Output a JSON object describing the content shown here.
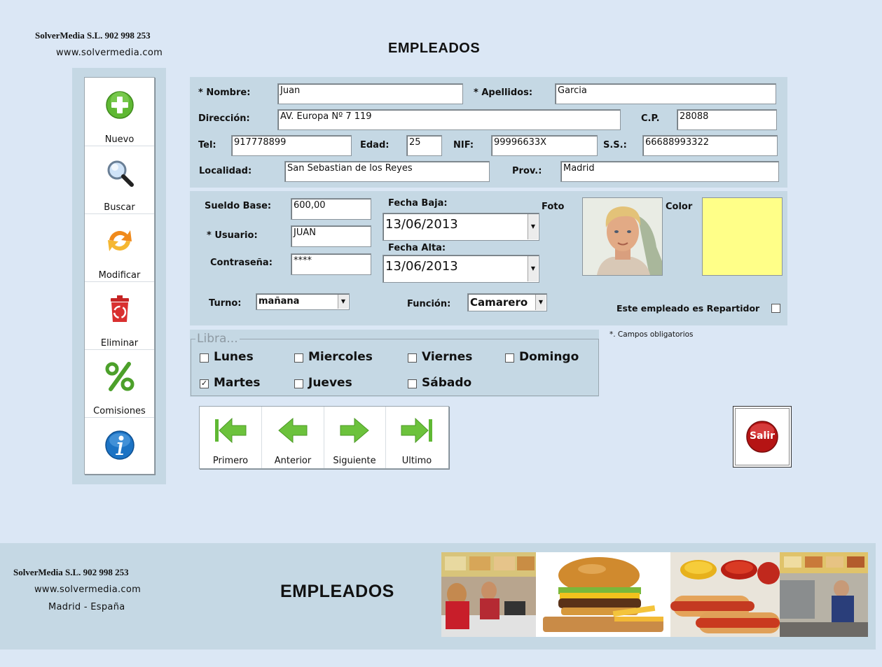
{
  "header": {
    "company": "SolverMedia S.L. 902 998 253",
    "website": "www.solvermedia.com",
    "title": "EMPLEADOS"
  },
  "sidebar": {
    "items": [
      {
        "label": "Nuevo",
        "icon": "plus-icon"
      },
      {
        "label": "Buscar",
        "icon": "magnifier-icon"
      },
      {
        "label": "Modificar",
        "icon": "refresh-arrows-icon"
      },
      {
        "label": "Eliminar",
        "icon": "recycle-bin-icon"
      },
      {
        "label": "Comisiones",
        "icon": "percent-icon"
      },
      {
        "label": "",
        "icon": "info-icon"
      }
    ]
  },
  "personal": {
    "nombre_label": "* Nombre:",
    "nombre": "Juan",
    "apellidos_label": "* Apellidos:",
    "apellidos": "Garcia",
    "direccion_label": "Dirección:",
    "direccion": "AV. Europa Nº 7 119",
    "cp_label": "C.P.",
    "cp": "28088",
    "tel_label": "Tel:",
    "tel": "917778899",
    "edad_label": "Edad:",
    "edad": "25",
    "nif_label": "NIF:",
    "nif": "99996633X",
    "ss_label": "S.S.:",
    "ss": "66688993322",
    "localidad_label": "Localidad:",
    "localidad": "San Sebastian de los Reyes",
    "prov_label": "Prov.:",
    "prov": "Madrid"
  },
  "work": {
    "sueldo_label": "Sueldo Base:",
    "sueldo": "600,00",
    "usuario_label": "* Usuario:",
    "usuario": "JUAN",
    "password_label": "Contraseña:",
    "password": "****",
    "fecha_baja_label": "Fecha Baja:",
    "fecha_baja": "13/06/2013",
    "fecha_alta_label": "Fecha Alta:",
    "fecha_alta": "13/06/2013",
    "foto_label": "Foto",
    "color_label": "Color",
    "color_value": "#ffff88",
    "turno_label": "Turno:",
    "turno": "mañana",
    "funcion_label": "Función:",
    "funcion": "Camarero",
    "repartidor_label": "Este empleado es Repartidor",
    "repartidor_checked": false
  },
  "required_note": "*. Campos obligatorios",
  "libra": {
    "legend": "Libra...",
    "days": [
      {
        "label": "Lunes",
        "checked": false
      },
      {
        "label": "Miercoles",
        "checked": false
      },
      {
        "label": "Viernes",
        "checked": false
      },
      {
        "label": "Domingo",
        "checked": false
      },
      {
        "label": "Martes",
        "checked": true
      },
      {
        "label": "Jueves",
        "checked": false
      },
      {
        "label": "Sábado",
        "checked": false
      }
    ]
  },
  "nav": {
    "items": [
      {
        "label": "Primero",
        "icon": "first-arrow-icon"
      },
      {
        "label": "Anterior",
        "icon": "left-arrow-icon"
      },
      {
        "label": "Siguiente",
        "icon": "right-arrow-icon"
      },
      {
        "label": "Ultimo",
        "icon": "last-arrow-icon"
      }
    ]
  },
  "exit": {
    "label": "Salir"
  },
  "footer": {
    "company": "SolverMedia S.L. 902 998 253",
    "website": "www.solvermedia.com",
    "location": "Madrid - España",
    "title": "EMPLEADOS"
  },
  "colors": {
    "background": "#dbe7f5",
    "panel": "#c5d8e4",
    "accent_green": "#5fb833",
    "salir_red": "#c41d1d"
  }
}
